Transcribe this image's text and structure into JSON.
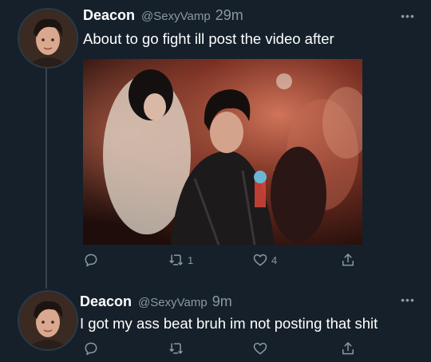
{
  "tweets": [
    {
      "name": "Deacon",
      "handle": "@SexyVamp",
      "time": "29m",
      "text": "About to go fight ill post the video after",
      "more": "•••",
      "retweets": "1",
      "likes": "4"
    },
    {
      "name": "Deacon",
      "handle": "@SexyVamp",
      "time": "9m",
      "text": "I got my ass beat bruh im not posting that shit",
      "more": "•••",
      "retweets": "",
      "likes": ""
    }
  ],
  "icons": [
    "reply-icon",
    "retweet-icon",
    "like-icon",
    "share-icon",
    "more-icon"
  ],
  "colors": {
    "background": "#15202b",
    "secondary_text": "#8b98a5",
    "thread_line": "#38444d"
  }
}
